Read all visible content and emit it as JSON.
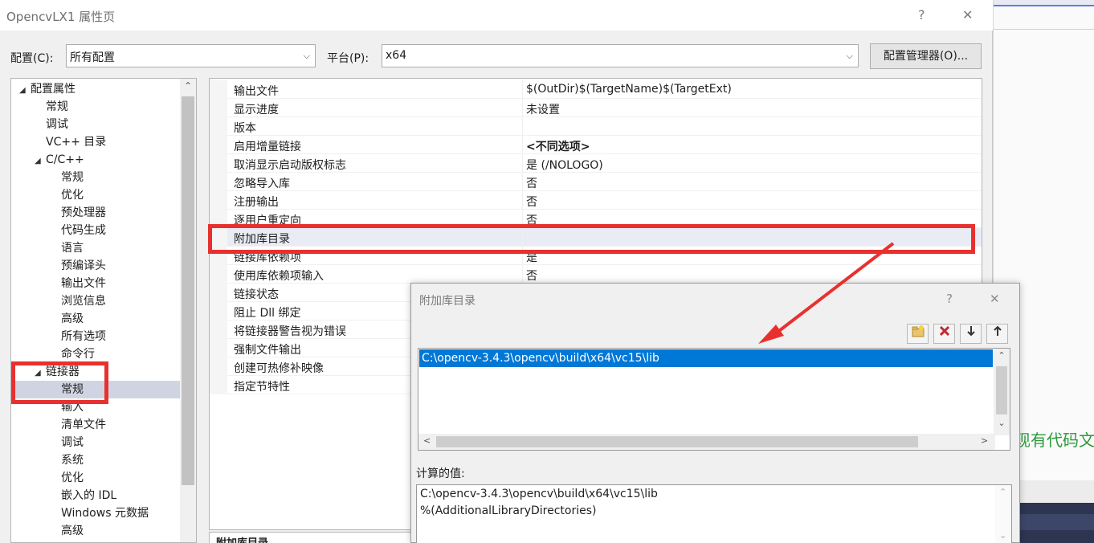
{
  "window": {
    "title": "OpencvLX1 属性页",
    "help": "?",
    "close": "✕"
  },
  "toolbar": {
    "config_label": "配置(C):",
    "config_value": "所有配置",
    "platform_label": "平台(P):",
    "platform_value": "x64",
    "manager_button": "配置管理器(O)..."
  },
  "tree": [
    {
      "label": "配置属性",
      "expanded": true
    },
    {
      "label": "常规"
    },
    {
      "label": "调试"
    },
    {
      "label": "VC++ 目录"
    },
    {
      "label": "C/C++",
      "expanded": true
    },
    {
      "label": "常规"
    },
    {
      "label": "优化"
    },
    {
      "label": "预处理器"
    },
    {
      "label": "代码生成"
    },
    {
      "label": "语言"
    },
    {
      "label": "预编译头"
    },
    {
      "label": "输出文件"
    },
    {
      "label": "浏览信息"
    },
    {
      "label": "高级"
    },
    {
      "label": "所有选项"
    },
    {
      "label": "命令行"
    },
    {
      "label": "链接器",
      "expanded": true
    },
    {
      "label": "常规",
      "selected": true
    },
    {
      "label": "输入"
    },
    {
      "label": "清单文件"
    },
    {
      "label": "调试"
    },
    {
      "label": "系统"
    },
    {
      "label": "优化"
    },
    {
      "label": "嵌入的 IDL"
    },
    {
      "label": "Windows 元数据"
    },
    {
      "label": "高级"
    }
  ],
  "properties": [
    {
      "name": "输出文件",
      "value": "$(OutDir)$(TargetName)$(TargetExt)"
    },
    {
      "name": "显示进度",
      "value": "未设置"
    },
    {
      "name": "版本",
      "value": ""
    },
    {
      "name": "启用增量链接",
      "value": "<不同选项>",
      "bold": true
    },
    {
      "name": "取消显示启动版权标志",
      "value": "是 (/NOLOGO)"
    },
    {
      "name": "忽略导入库",
      "value": "否"
    },
    {
      "name": "注册输出",
      "value": "否"
    },
    {
      "name": "逐用户重定向",
      "value": "否"
    },
    {
      "name": "附加库目录",
      "value": "",
      "highlight": true
    },
    {
      "name": "链接库依赖项",
      "value": "是"
    },
    {
      "name": "使用库依赖项输入",
      "value": "否"
    },
    {
      "name": "链接状态",
      "value": ""
    },
    {
      "name": "阻止 Dll 绑定",
      "value": ""
    },
    {
      "name": "将链接器警告视为错误",
      "value": ""
    },
    {
      "name": "强制文件输出",
      "value": ""
    },
    {
      "name": "创建可热修补映像",
      "value": ""
    },
    {
      "name": "指定节特性",
      "value": ""
    }
  ],
  "description": {
    "title": "附加库目录"
  },
  "subdialog": {
    "title": "附加库目录",
    "help": "?",
    "close": "✕",
    "list_item": "C:\\opencv-3.4.3\\opencv\\build\\x64\\vc15\\lib",
    "computed_label": "计算的值:",
    "computed_lines": [
      "C:\\opencv-3.4.3\\opencv\\build\\x64\\vc15\\lib",
      "%(AdditionalLibraryDirectories)"
    ]
  },
  "background": {
    "partial_text": "现有代码文"
  },
  "colors": {
    "annotation": "#e8312f",
    "selection": "#0078d7"
  }
}
